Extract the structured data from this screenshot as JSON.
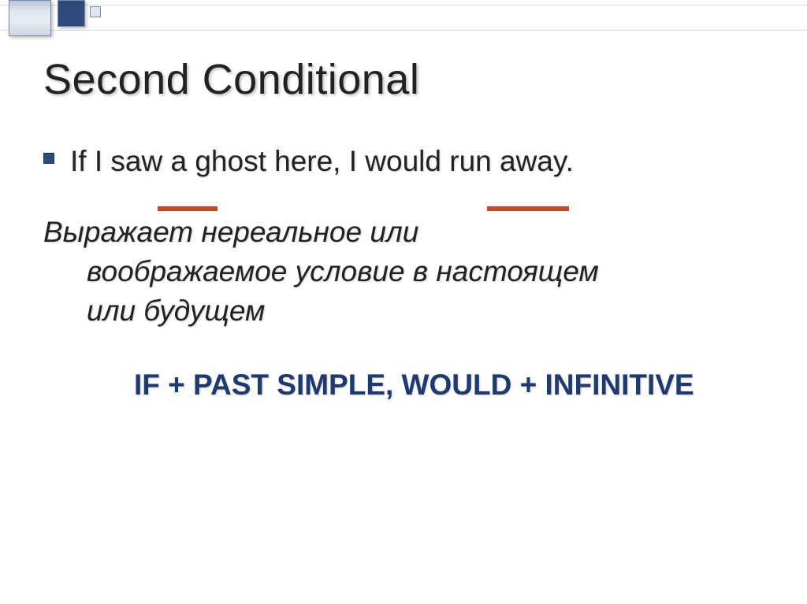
{
  "slide": {
    "title": "Second Conditional",
    "example_text": "If I saw a ghost here, I would run away.",
    "explanation_line1": "Выражает нереальное или",
    "explanation_line2": "воображаемое условие в настоящем",
    "explanation_line3": "или будущем",
    "formula": "IF + PAST SIMPLE, WOULD + INFINITIVE"
  }
}
